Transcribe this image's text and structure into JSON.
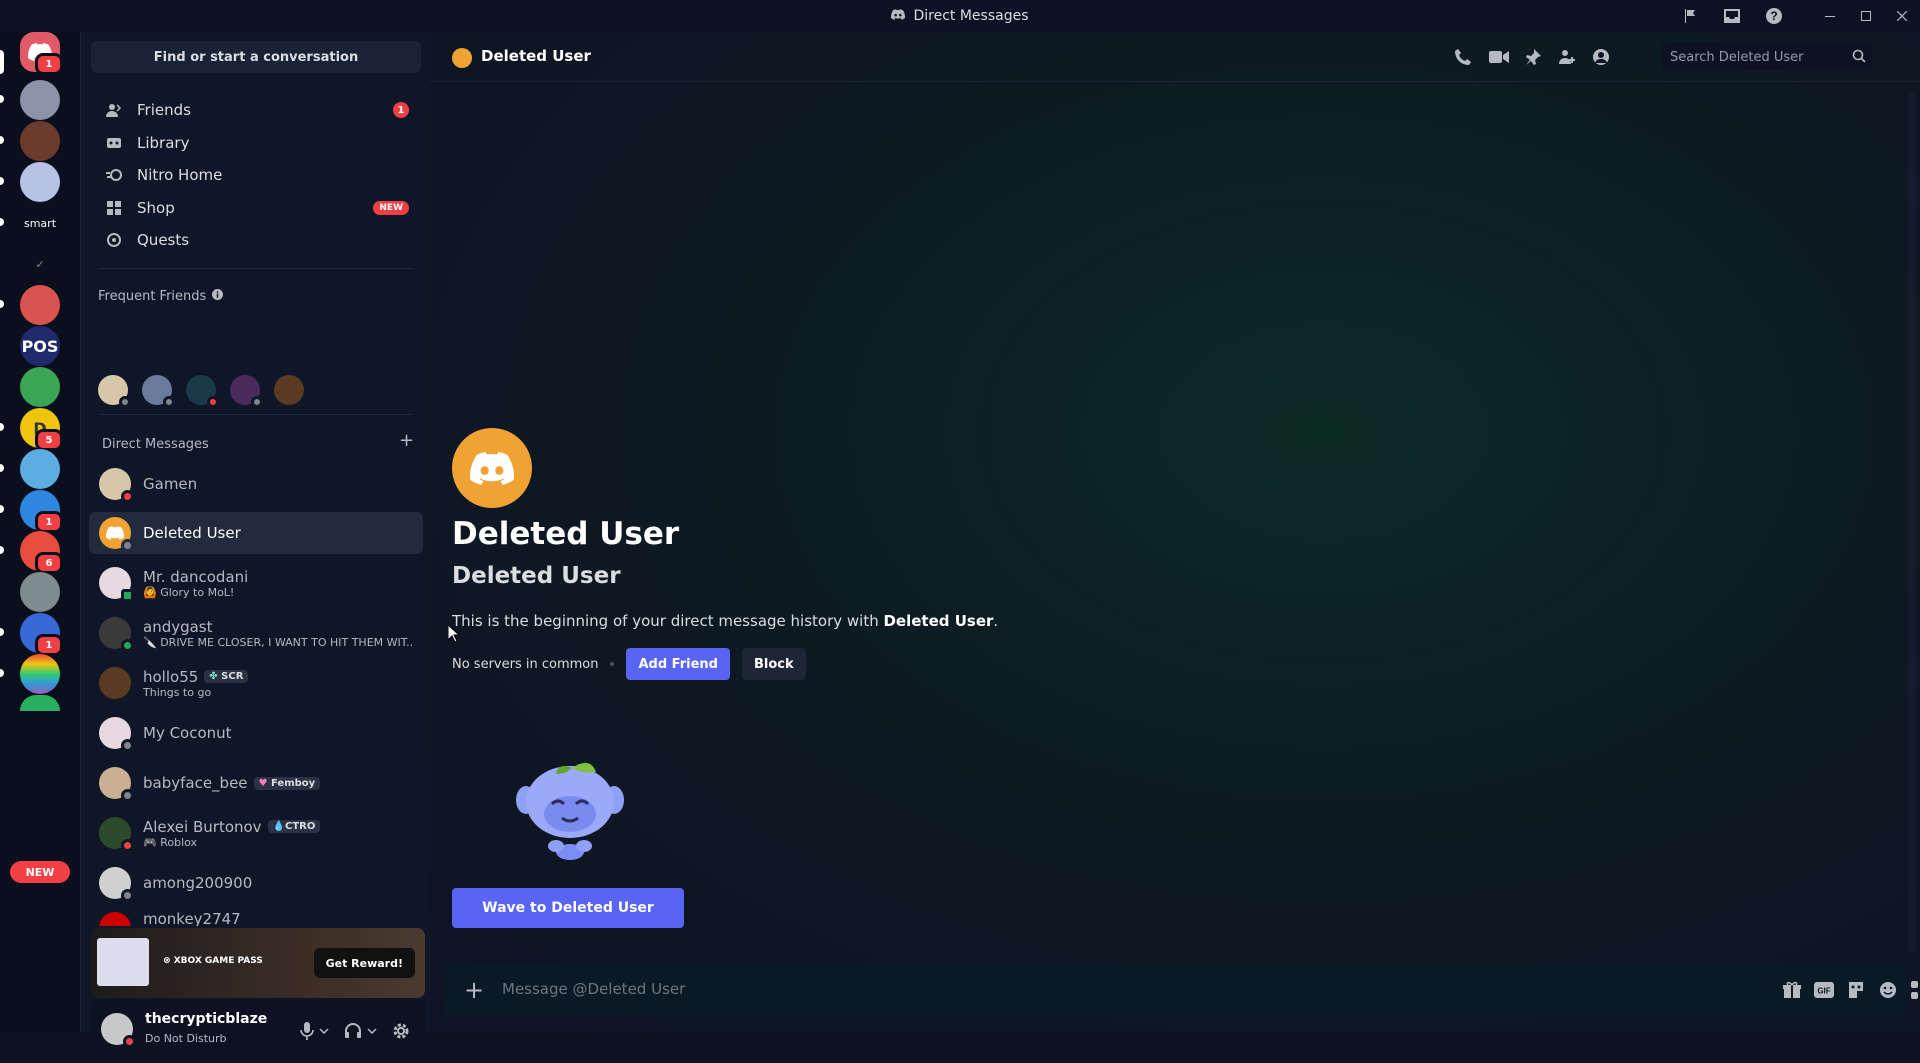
{
  "window": {
    "title": "Direct Messages"
  },
  "guild_badges": {
    "home": "1",
    "g10": "5",
    "g12": "1",
    "g13": "6",
    "g15": "1"
  },
  "guild_labels": {
    "smart": "smart",
    "pos": "POS",
    "d": "D"
  },
  "new_pill": "NEW",
  "sidebar": {
    "search_label": "Find or start a conversation",
    "nav": [
      {
        "label": "Friends",
        "badge": "1"
      },
      {
        "label": "Library"
      },
      {
        "label": "Nitro Home"
      },
      {
        "label": "Shop",
        "badge": "NEW"
      },
      {
        "label": "Quests"
      }
    ],
    "frequent_friends_title": "Frequent Friends",
    "dm_title": "Direct Messages",
    "dms": [
      {
        "name": "Gamen",
        "status": "dnd"
      },
      {
        "name": "Deleted User",
        "status": "offline",
        "active": true
      },
      {
        "name": "Mr. dancodani",
        "sub": "Glory to MoL!",
        "status": "on"
      },
      {
        "name": "andygast",
        "sub": "DRIVE ME CLOSER, I WANT TO HIT THEM WIT...",
        "status": "on"
      },
      {
        "name": "hollo55",
        "tag": "SCR",
        "sub": "Things to go",
        "status": "none"
      },
      {
        "name": "My Coconut",
        "status": "offline"
      },
      {
        "name": "babyface_bee",
        "tag": "Femboy",
        "status": "offline"
      },
      {
        "name": "Alexei Burtonov",
        "tag": "CTRO",
        "sub": "Roblox",
        "status": "dnd"
      },
      {
        "name": "among200900",
        "status": "offline"
      },
      {
        "name": "monkey2747"
      }
    ],
    "promo": {
      "brand": "XBOX GAME PASS",
      "button": "Get Reward!"
    },
    "user": {
      "name": "thecrypticblaze",
      "status": "Do Not Disturb"
    }
  },
  "chat": {
    "header_name": "Deleted User",
    "search_placeholder": "Search Deleted User",
    "welcome_title": "Deleted User",
    "welcome_sub": "Deleted User",
    "desc_prefix": "This is the beginning of your direct message history with ",
    "desc_name": "Deleted User",
    "desc_suffix": ".",
    "no_common": "No servers in common",
    "add_friend": "Add Friend",
    "block": "Block",
    "wave_button": "Wave to Deleted User",
    "composer_placeholder": "Message @Deleted User"
  },
  "colors": {
    "accent": "#5865f2",
    "danger": "#f23f43",
    "online": "#23a55a",
    "deleted_user": "#f0a232"
  }
}
